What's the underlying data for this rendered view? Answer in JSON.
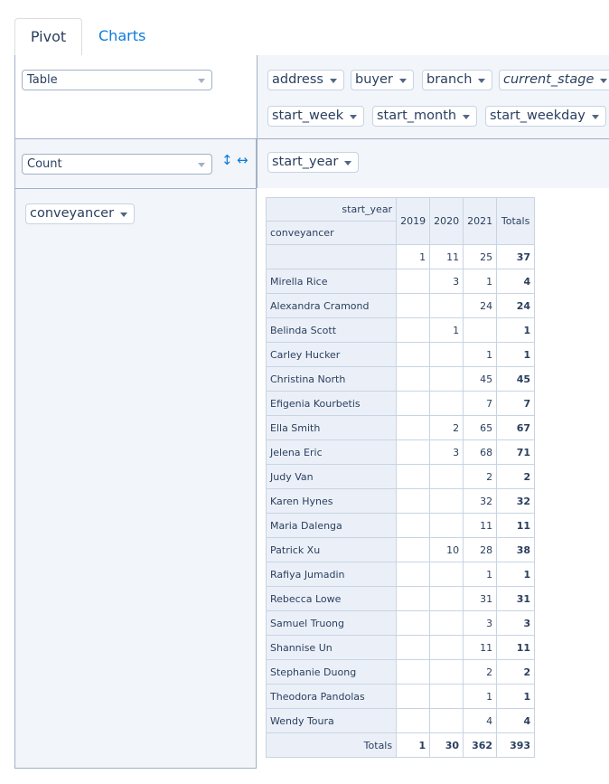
{
  "tabs": [
    {
      "label": "Pivot"
    },
    {
      "label": "Charts"
    }
  ],
  "renderer": {
    "value": "Table"
  },
  "aggregator": {
    "value": "Count"
  },
  "unused_attrs": [
    "address",
    "buyer",
    "branch",
    "current_stage",
    "start_week",
    "start_month",
    "start_weekday"
  ],
  "col_attrs": [
    "start_year"
  ],
  "row_attrs": [
    "conveyancer"
  ],
  "icons": {
    "sort_rows": "vertical-arrows-icon",
    "sort_cols": "horizontal-arrows-icon",
    "accent": "#0c7bdc"
  },
  "table": {
    "col_axis_label": "start_year",
    "row_axis_label": "conveyancer",
    "col_headers": [
      "2019",
      "2020",
      "2021"
    ],
    "totals_label": "Totals",
    "rows": [
      {
        "label": "",
        "values": [
          "1",
          "11",
          "25"
        ],
        "total": "37"
      },
      {
        "label": "Mirella Rice",
        "values": [
          "",
          "3",
          "1"
        ],
        "total": "4"
      },
      {
        "label": "Alexandra Cramond",
        "values": [
          "",
          "",
          "24"
        ],
        "total": "24"
      },
      {
        "label": "Belinda Scott",
        "values": [
          "",
          "1",
          ""
        ],
        "total": "1"
      },
      {
        "label": "Carley Hucker",
        "values": [
          "",
          "",
          "1"
        ],
        "total": "1"
      },
      {
        "label": "Christina North",
        "values": [
          "",
          "",
          "45"
        ],
        "total": "45"
      },
      {
        "label": "Efigenia Kourbetis",
        "values": [
          "",
          "",
          "7"
        ],
        "total": "7"
      },
      {
        "label": "Ella Smith",
        "values": [
          "",
          "2",
          "65"
        ],
        "total": "67"
      },
      {
        "label": "Jelena Eric",
        "values": [
          "",
          "3",
          "68"
        ],
        "total": "71"
      },
      {
        "label": "Judy Van",
        "values": [
          "",
          "",
          "2"
        ],
        "total": "2"
      },
      {
        "label": "Karen Hynes",
        "values": [
          "",
          "",
          "32"
        ],
        "total": "32"
      },
      {
        "label": "Maria Dalenga",
        "values": [
          "",
          "",
          "11"
        ],
        "total": "11"
      },
      {
        "label": "Patrick Xu",
        "values": [
          "",
          "10",
          "28"
        ],
        "total": "38"
      },
      {
        "label": "Rafiya Jumadin",
        "values": [
          "",
          "",
          "1"
        ],
        "total": "1"
      },
      {
        "label": "Rebecca Lowe",
        "values": [
          "",
          "",
          "31"
        ],
        "total": "31"
      },
      {
        "label": "Samuel Truong",
        "values": [
          "",
          "",
          "3"
        ],
        "total": "3"
      },
      {
        "label": "Shannise Un",
        "values": [
          "",
          "",
          "11"
        ],
        "total": "11"
      },
      {
        "label": "Stephanie Duong",
        "values": [
          "",
          "",
          "2"
        ],
        "total": "2"
      },
      {
        "label": "Theodora Pandolas",
        "values": [
          "",
          "",
          "1"
        ],
        "total": "1"
      },
      {
        "label": "Wendy Toura",
        "values": [
          "",
          "",
          "4"
        ],
        "total": "4"
      }
    ],
    "col_totals": [
      "1",
      "30",
      "362"
    ],
    "grand_total": "393"
  }
}
